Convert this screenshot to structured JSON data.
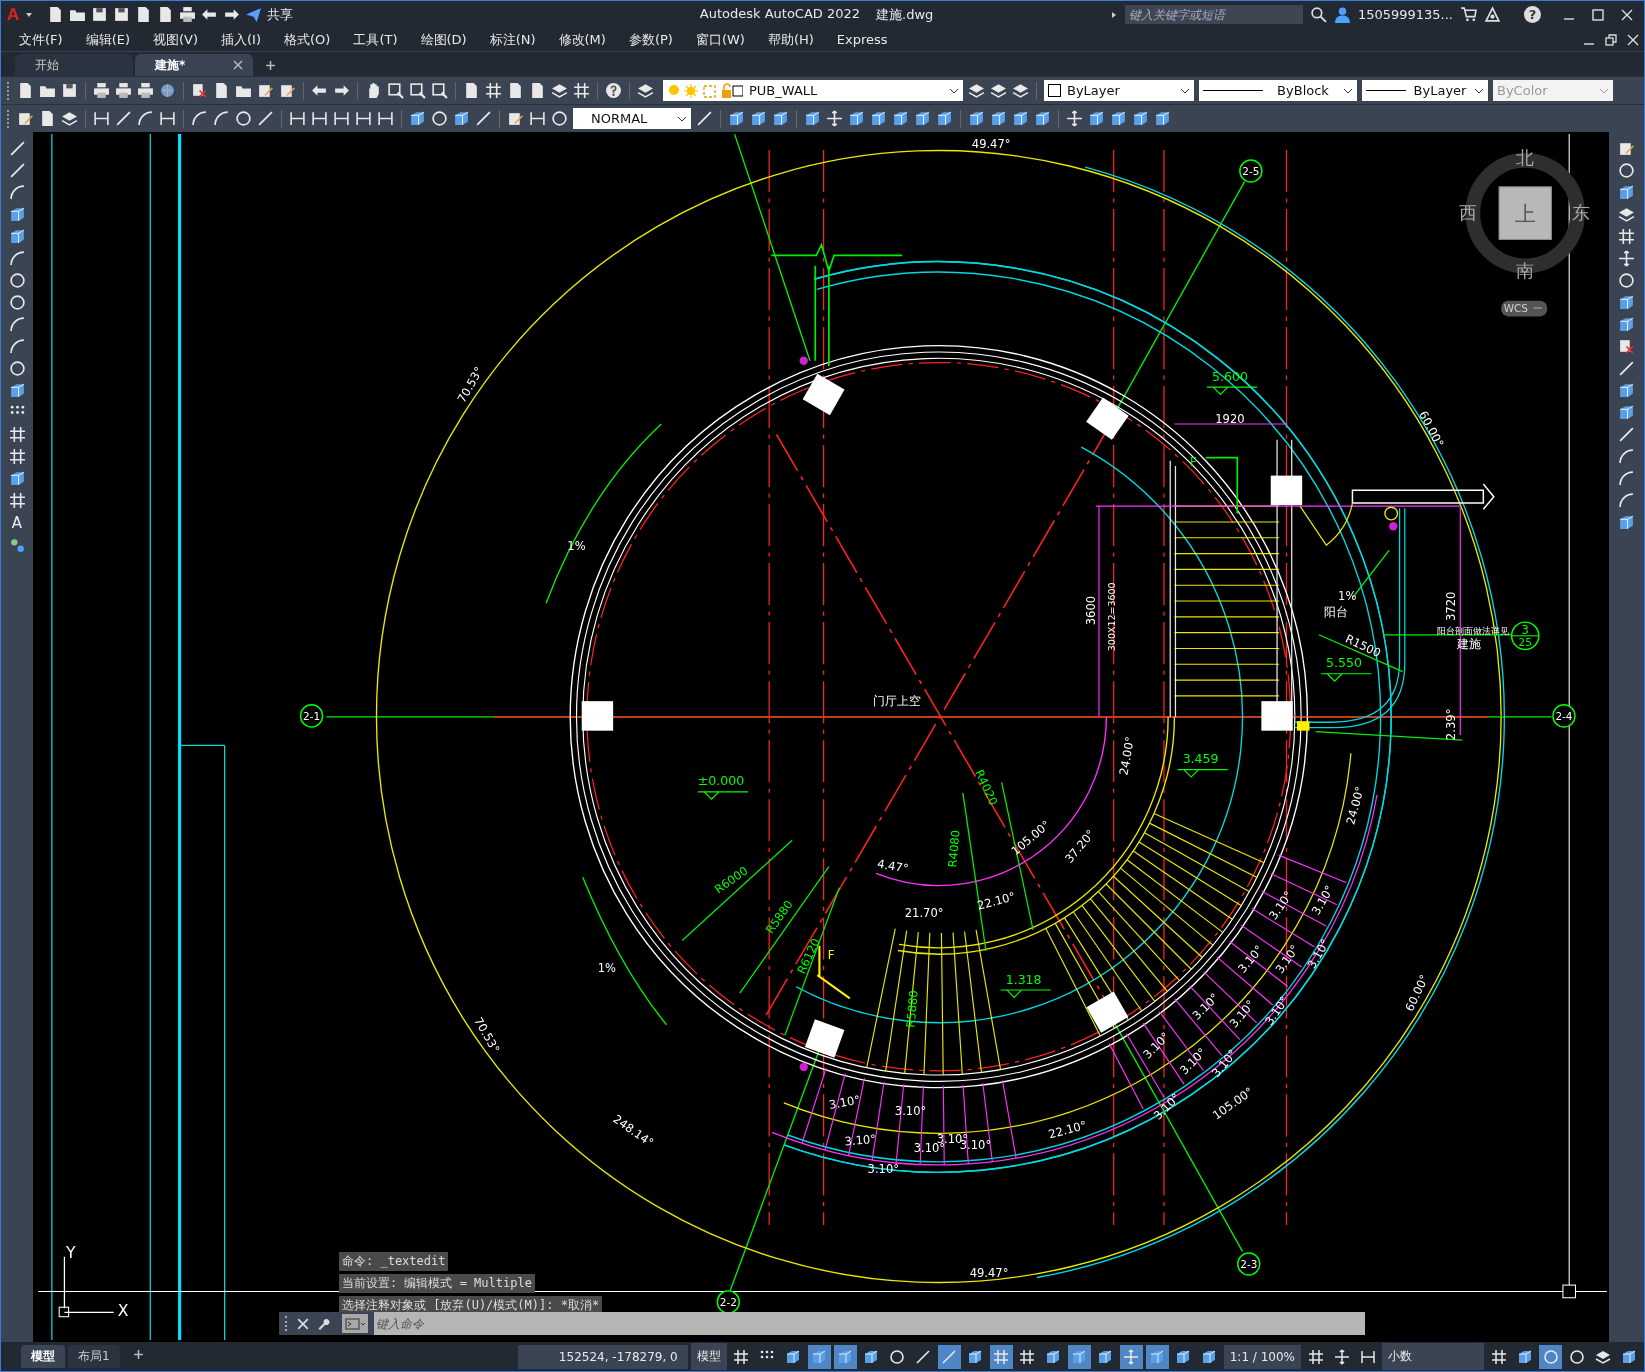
{
  "title_bar": {
    "logo": "A",
    "share": "共享",
    "app_title": "Autodesk AutoCAD 2022",
    "file_name": "建施.dwg",
    "search_placeholder": "键入关键字或短语",
    "user": "1505999135...",
    "help": "?"
  },
  "menu": [
    "文件(F)",
    "编辑(E)",
    "视图(V)",
    "插入(I)",
    "格式(O)",
    "工具(T)",
    "绘图(D)",
    "标注(N)",
    "修改(M)",
    "参数(P)",
    "窗口(W)",
    "帮助(H)",
    "Express"
  ],
  "doc_tabs": [
    {
      "label": "开始",
      "selected": false
    },
    {
      "label": "建施*",
      "selected": true
    }
  ],
  "toolbar": {
    "layer": "PUB_WALL",
    "text_style": "NORMAL",
    "color_setting": "ByLayer",
    "linetype": "ByBlock",
    "lineweight": "ByLayer",
    "plot_style": "ByColor"
  },
  "palette_text_tool": "A",
  "viewcube": {
    "north": "北",
    "west": "西",
    "east": "东",
    "south": "南",
    "top": "上",
    "wcs": "WCS"
  },
  "ucs": {
    "y": "Y",
    "x": "X"
  },
  "drawing_labels": [
    {
      "kind": "text",
      "text": "49.47°"
    },
    {
      "kind": "text",
      "text": "70.53°"
    },
    {
      "kind": "text",
      "text": "60.00°"
    },
    {
      "kind": "bubble",
      "text": "2-5"
    },
    {
      "kind": "level",
      "text": "5.600"
    },
    {
      "kind": "text",
      "text": "1920"
    },
    {
      "kind": "text",
      "text": "F"
    },
    {
      "kind": "text",
      "text": "1%"
    },
    {
      "kind": "text",
      "text": "3600"
    },
    {
      "kind": "text",
      "text": "300X12=3600"
    },
    {
      "kind": "text",
      "text": "1%"
    },
    {
      "kind": "text",
      "text": "阳台"
    },
    {
      "kind": "text",
      "text": "3720"
    },
    {
      "kind": "text",
      "text": "阳台剖面做法详见"
    },
    {
      "kind": "text",
      "text": "建施"
    },
    {
      "kind": "detail",
      "text": "3",
      "sub": "25"
    },
    {
      "kind": "text",
      "text": "R1500"
    },
    {
      "kind": "level",
      "text": "5.550"
    },
    {
      "kind": "bubble",
      "text": "2-1"
    },
    {
      "kind": "bubble",
      "text": "2-4"
    },
    {
      "kind": "text",
      "text": "门厅上空"
    },
    {
      "kind": "text",
      "text": "2.39°"
    },
    {
      "kind": "text",
      "text": "24.00°"
    },
    {
      "kind": "level",
      "text": "3.459"
    },
    {
      "kind": "level",
      "text": "±0.000"
    },
    {
      "kind": "text",
      "text": "R4020"
    },
    {
      "kind": "text",
      "text": "24.00°"
    },
    {
      "kind": "text",
      "text": "105.00°"
    },
    {
      "kind": "text",
      "text": "37.20°"
    },
    {
      "kind": "text",
      "text": "R4080"
    },
    {
      "kind": "text",
      "text": "4.47°"
    },
    {
      "kind": "text",
      "text": "R6000"
    },
    {
      "kind": "text",
      "text": "21.70°"
    },
    {
      "kind": "text",
      "text": "22.10°"
    },
    {
      "kind": "text",
      "text": "R5880"
    },
    {
      "kind": "text",
      "text": "F"
    },
    {
      "kind": "text",
      "text": "R6120"
    },
    {
      "kind": "text",
      "text": "1%"
    },
    {
      "kind": "level",
      "text": "1.318"
    },
    {
      "kind": "text",
      "text": "R5880"
    },
    {
      "kind": "text",
      "text": "60.00°"
    },
    {
      "kind": "text",
      "text": "70.53°"
    },
    {
      "kind": "text",
      "text": "248.14°"
    },
    {
      "kind": "text",
      "text": "22.10°"
    },
    {
      "kind": "text",
      "text": "105.00°"
    },
    {
      "kind": "bubble",
      "text": "2-2"
    },
    {
      "kind": "bubble",
      "text": "2-3"
    },
    {
      "kind": "text",
      "text": "49.47°"
    },
    {
      "kind": "text",
      "text": "3.10°"
    },
    {
      "kind": "text",
      "text": "3.10°"
    },
    {
      "kind": "text",
      "text": "3.10°"
    },
    {
      "kind": "text",
      "text": "3.10°"
    },
    {
      "kind": "text",
      "text": "3.10°"
    },
    {
      "kind": "text",
      "text": "3.10°"
    },
    {
      "kind": "text",
      "text": "3.10°"
    },
    {
      "kind": "text",
      "text": "3.10°"
    },
    {
      "kind": "text",
      "text": "3.10°"
    },
    {
      "kind": "text",
      "text": "3.10°"
    },
    {
      "kind": "text",
      "text": "3.10°"
    },
    {
      "kind": "text",
      "text": "3.10°"
    },
    {
      "kind": "text",
      "text": "3.10°"
    },
    {
      "kind": "text",
      "text": "3.10°"
    },
    {
      "kind": "text",
      "text": "3.10°"
    },
    {
      "kind": "text",
      "text": "3.10°"
    },
    {
      "kind": "text",
      "text": "3.10°"
    },
    {
      "kind": "text",
      "text": "3.10°"
    },
    {
      "kind": "text",
      "text": "3.10°"
    }
  ],
  "command_history": [
    "命令: _textedit",
    "当前设置: 编辑模式 = Multiple",
    "选择注释对象或 [放弃(U)/模式(M)]: *取消*"
  ],
  "command_placeholder": "键入命令",
  "layout_tabs": [
    {
      "label": "模型",
      "selected": true
    },
    {
      "label": "布局1",
      "selected": false
    }
  ],
  "status_bar": {
    "coordinates": "152524, -178279, 0",
    "space": "模型",
    "scale": "1:1 / 100%",
    "units": "小数"
  },
  "status_toggles": [
    {
      "on": false
    },
    {
      "on": false
    },
    {
      "on": false
    },
    {
      "on": true
    },
    {
      "on": true
    },
    {
      "on": false
    },
    {
      "on": false
    },
    {
      "on": false
    },
    {
      "on": true
    },
    {
      "on": false
    },
    {
      "on": true
    },
    {
      "on": false
    },
    {
      "on": false
    },
    {
      "on": true
    },
    {
      "on": false
    },
    {
      "on": true
    },
    {
      "on": true
    },
    {
      "on": false
    },
    {
      "on": false
    }
  ],
  "status_tools": [
    {
      "on": false
    },
    {
      "on": false
    },
    {
      "on": false
    },
    {
      "on": false
    },
    {
      "on": false
    },
    {
      "on": true
    },
    {
      "on": false
    },
    {
      "on": false
    },
    {
      "on": false
    }
  ]
}
